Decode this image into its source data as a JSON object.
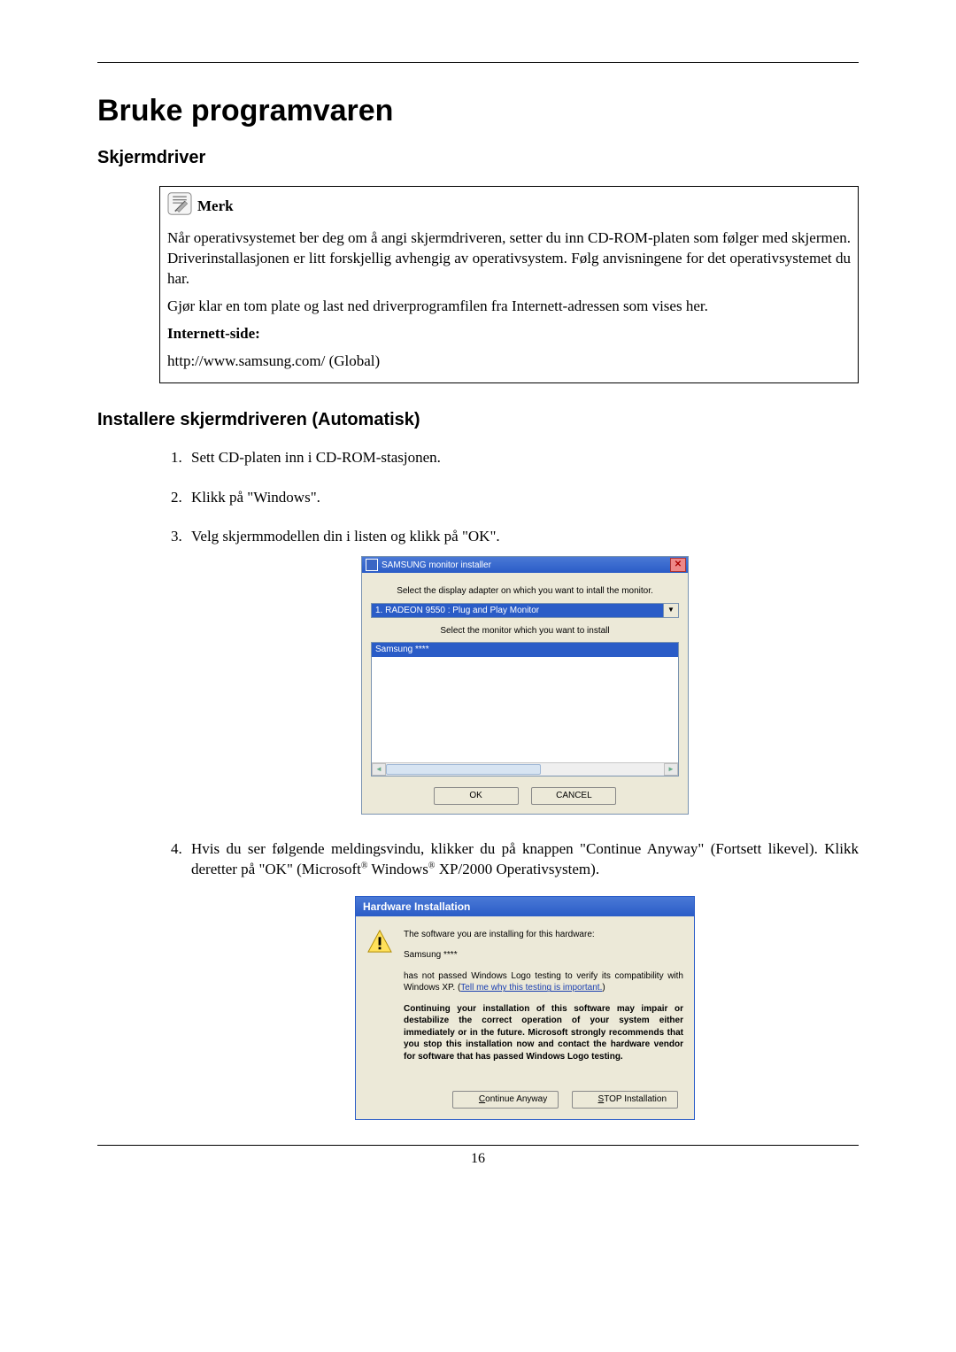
{
  "page_number": "16",
  "main_title": "Bruke programvaren",
  "section1_heading": "Skjermdriver",
  "note": {
    "label": "Merk",
    "para1": "Når operativsystemet ber deg om å angi skjermdriveren, setter du inn CD-ROM-platen som følger med skjermen. Driverinstallasjonen er litt forskjellig avhengig av operativsystem. Følg anvisningene for det operativsystemet du har.",
    "para2": "Gjør klar en tom plate og last ned driverprogramfilen fra Internett-adressen som vises her.",
    "internet_label": "Internett-side:",
    "url": "http://www.samsung.com/ (Global)"
  },
  "section2_heading": "Installere skjermdriveren (Automatisk)",
  "steps": {
    "s1": "Sett CD-platen inn i CD-ROM-stasjonen.",
    "s2": "Klikk på \"Windows\".",
    "s3": "Velg skjermmodellen din i listen og klikk på \"OK\".",
    "s4_a": "Hvis du ser følgende meldingsvindu, klikker du på knappen \"Continue Anyway\" (Fortsett likevel). Klikk deretter på \"OK\" (Microsoft",
    "s4_b": " Windows",
    "s4_c": " XP/2000 Operativsystem)."
  },
  "installer": {
    "title": "SAMSUNG monitor installer",
    "line1": "Select the display adapter on which you want to intall the monitor.",
    "dropdown": "1. RADEON 9550 : Plug and Play Monitor",
    "line2": "Select the monitor which you want to install",
    "selected": "Samsung ****",
    "ok": "OK",
    "cancel": "CANCEL"
  },
  "hw": {
    "title": "Hardware Installation",
    "p1": "The software you are installing for this hardware:",
    "p2": "Samsung ****",
    "p3a": "has not passed Windows Logo testing to verify its compatibility with Windows XP. (",
    "p3link": "Tell me why this testing is important.",
    "p3b": ")",
    "p4": "Continuing your installation of this software may impair or destabilize the correct operation of your system either immediately or in the future. Microsoft strongly recommends that you stop this installation now and contact the hardware vendor for software that has passed Windows Logo testing.",
    "btn_continue": "Continue Anyway",
    "btn_stop": "STOP Installation"
  }
}
